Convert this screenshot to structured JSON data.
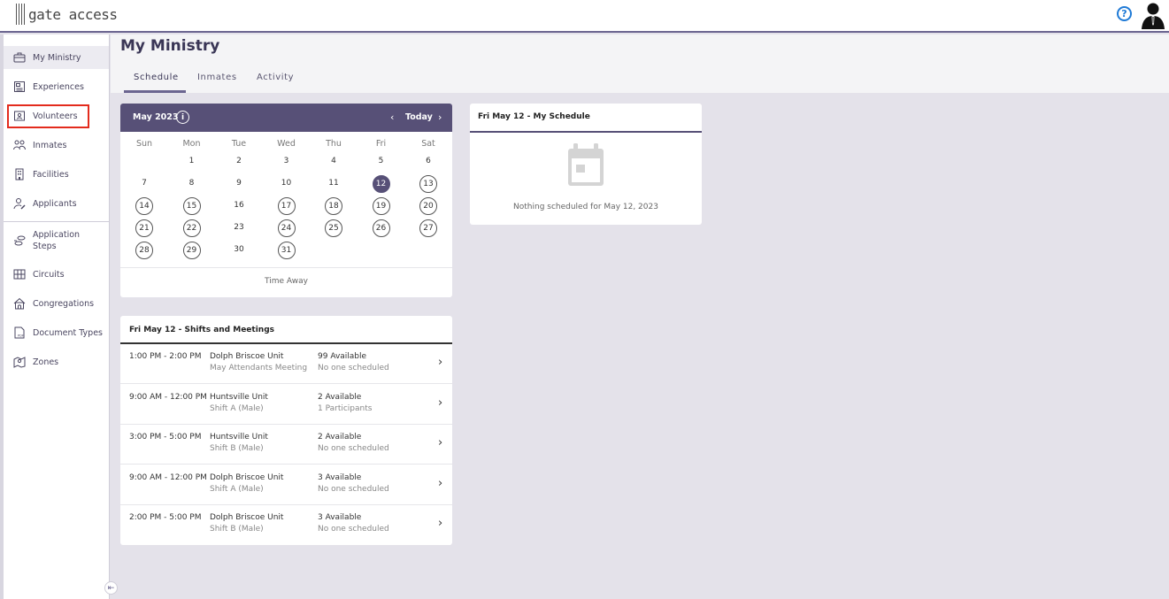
{
  "app": {
    "brand": "gate access",
    "help_glyph": "?"
  },
  "sidebar": {
    "items": [
      {
        "label": "My Ministry",
        "icon": "briefcase-icon"
      },
      {
        "label": "Experiences",
        "icon": "newspaper-icon"
      },
      {
        "label": "Volunteers",
        "icon": "id-badge-icon"
      },
      {
        "label": "Inmates",
        "icon": "people-icon"
      },
      {
        "label": "Facilities",
        "icon": "building-icon"
      },
      {
        "label": "Applicants",
        "icon": "user-edit-icon"
      },
      {
        "label_line1": "Application",
        "label_line2": "Steps",
        "icon": "steps-icon"
      },
      {
        "label": "Circuits",
        "icon": "map-grid-icon"
      },
      {
        "label": "Congregations",
        "icon": "church-icon"
      },
      {
        "label": "Document Types",
        "icon": "pdf-doc-icon"
      },
      {
        "label": "Zones",
        "icon": "map-zone-icon"
      }
    ],
    "collapse_glyph": "⇤"
  },
  "page": {
    "title": "My Ministry",
    "tabs": [
      "Schedule",
      "Inmates",
      "Activity"
    ]
  },
  "calendar": {
    "month_label": "May 2023",
    "info_glyph": "i",
    "prev_glyph": "‹",
    "today_label": "Today",
    "next_glyph": "›",
    "weekdays": [
      "Sun",
      "Mon",
      "Tue",
      "Wed",
      "Thu",
      "Fri",
      "Sat"
    ],
    "days": [
      "1",
      "2",
      "3",
      "4",
      "5",
      "6",
      "7",
      "8",
      "9",
      "10",
      "11",
      "12",
      "13",
      "14",
      "15",
      "16",
      "17",
      "18",
      "19",
      "20",
      "21",
      "22",
      "23",
      "24",
      "25",
      "26",
      "27",
      "28",
      "29",
      "30",
      "31"
    ],
    "selected_day": "12",
    "time_away_label": "Time Away"
  },
  "shifts": {
    "title": "Fri May 12 - Shifts and Meetings",
    "rows": [
      {
        "time": "1:00 PM - 2:00 PM",
        "unit": "Dolph Briscoe Unit",
        "sub": "May Attendants Meeting",
        "available": "99 Available",
        "participants": "No one scheduled"
      },
      {
        "time": "9:00 AM - 12:00 PM",
        "unit": "Huntsville Unit",
        "sub": "Shift A (Male)",
        "available": "2 Available",
        "participants": "1 Participants"
      },
      {
        "time": "3:00 PM - 5:00 PM",
        "unit": "Huntsville Unit",
        "sub": "Shift B (Male)",
        "available": "2 Available",
        "participants": "No one scheduled"
      },
      {
        "time": "9:00 AM - 12:00 PM",
        "unit": "Dolph Briscoe Unit",
        "sub": "Shift A (Male)",
        "available": "3 Available",
        "participants": "No one scheduled"
      },
      {
        "time": "2:00 PM - 5:00 PM",
        "unit": "Dolph Briscoe Unit",
        "sub": "Shift B (Male)",
        "available": "3 Available",
        "participants": "No one scheduled"
      }
    ],
    "chevron_glyph": "›"
  },
  "my_schedule": {
    "title": "Fri May 12 - My Schedule",
    "empty_text": "Nothing scheduled for May 12, 2023",
    "icon": "calendar-icon"
  },
  "colors": {
    "accent": "#575077",
    "highlight": "#e32b1d",
    "help": "#1f7ad6"
  }
}
